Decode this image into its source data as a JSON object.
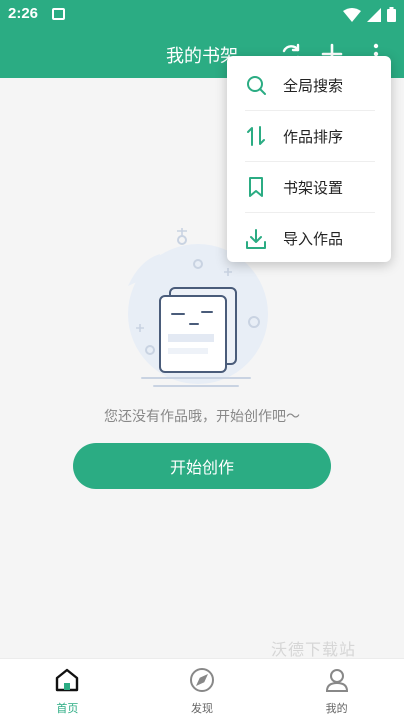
{
  "status_bar": {
    "time": "2:26"
  },
  "app_bar": {
    "title": "我的书架"
  },
  "menu": {
    "items": [
      {
        "label": "全局搜索",
        "icon": "search-icon"
      },
      {
        "label": "作品排序",
        "icon": "sort-icon"
      },
      {
        "label": "书架设置",
        "icon": "bookmark-icon"
      },
      {
        "label": "导入作品",
        "icon": "download-icon"
      }
    ]
  },
  "empty_state": {
    "message": "您还没有作品哦，开始创作吧～",
    "button_label": "开始创作"
  },
  "watermark": "沃德下载站",
  "bottom_nav": {
    "items": [
      {
        "label": "首页",
        "icon": "home-icon",
        "active": true
      },
      {
        "label": "发现",
        "icon": "compass-icon",
        "active": false
      },
      {
        "label": "我的",
        "icon": "profile-icon",
        "active": false
      }
    ]
  },
  "colors": {
    "accent": "#2bac83",
    "background": "#f5f5f5",
    "text_secondary": "#888888"
  }
}
